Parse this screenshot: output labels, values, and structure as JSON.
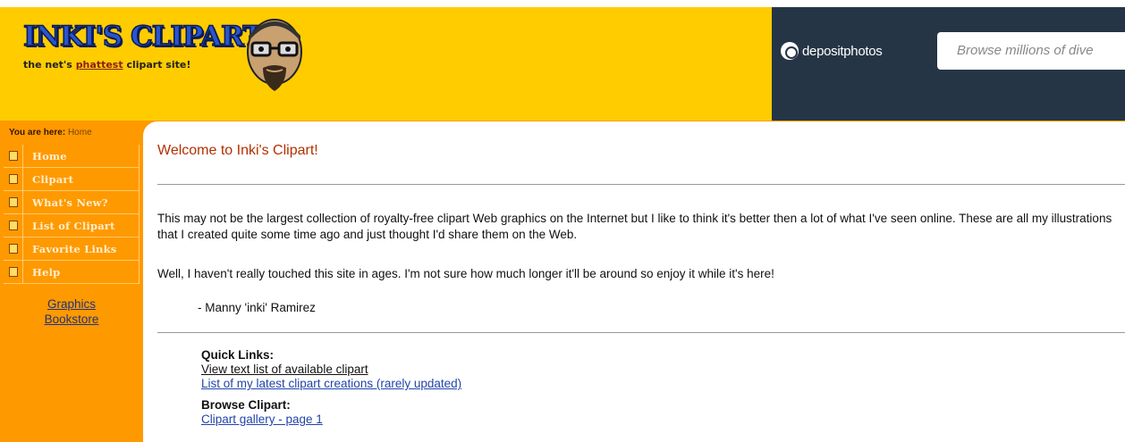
{
  "header": {
    "logo_title": "INKI'S CLIPART",
    "tagline_before": "the net's ",
    "tagline_hot": "phattest",
    "tagline_after": " clipart site!",
    "ad_brand": "depositphotos",
    "ad_search_placeholder": "Browse millions of dive"
  },
  "breadcrumb": {
    "prefix": "You are here:",
    "current": "Home"
  },
  "sidebar": {
    "items": [
      {
        "label": "Home",
        "icon": "home-icon"
      },
      {
        "label": "Clipart",
        "icon": "clipart-icon"
      },
      {
        "label": "What's New?",
        "icon": "new-icon"
      },
      {
        "label": "List of Clipart",
        "icon": "list-icon"
      },
      {
        "label": "Favorite Links",
        "icon": "links-icon"
      },
      {
        "label": "Help",
        "icon": "help-icon"
      }
    ],
    "bookstore_line1": "Graphics",
    "bookstore_line2": "Bookstore"
  },
  "main": {
    "welcome": "Welcome to Inki's Clipart!",
    "intro": "This may not be the largest collection of royalty-free clipart Web graphics on the Internet but I like to think it's better then a lot of what I've seen online. These are all my illustrations that I created quite some time ago and just thought I'd share them on the Web.",
    "intro2": "Well, I haven't really touched this site in ages. I'm not sure how much longer it'll be around so enjoy it while it's here!",
    "signature": "- Manny 'inki' Ramirez",
    "quick_links_heading": "Quick Links:",
    "quick_link_1": "View text list of available clipart",
    "quick_link_2": "List of my latest clipart creations (rarely updated)",
    "browse_heading": "Browse Clipart:",
    "browse_link_1": "Clipart gallery - page 1"
  },
  "colors": {
    "header_bg": "#ffcc00",
    "orange": "#ff9900",
    "ad_bg": "#253545",
    "welcome": "#b33000",
    "link": "#2244aa"
  }
}
